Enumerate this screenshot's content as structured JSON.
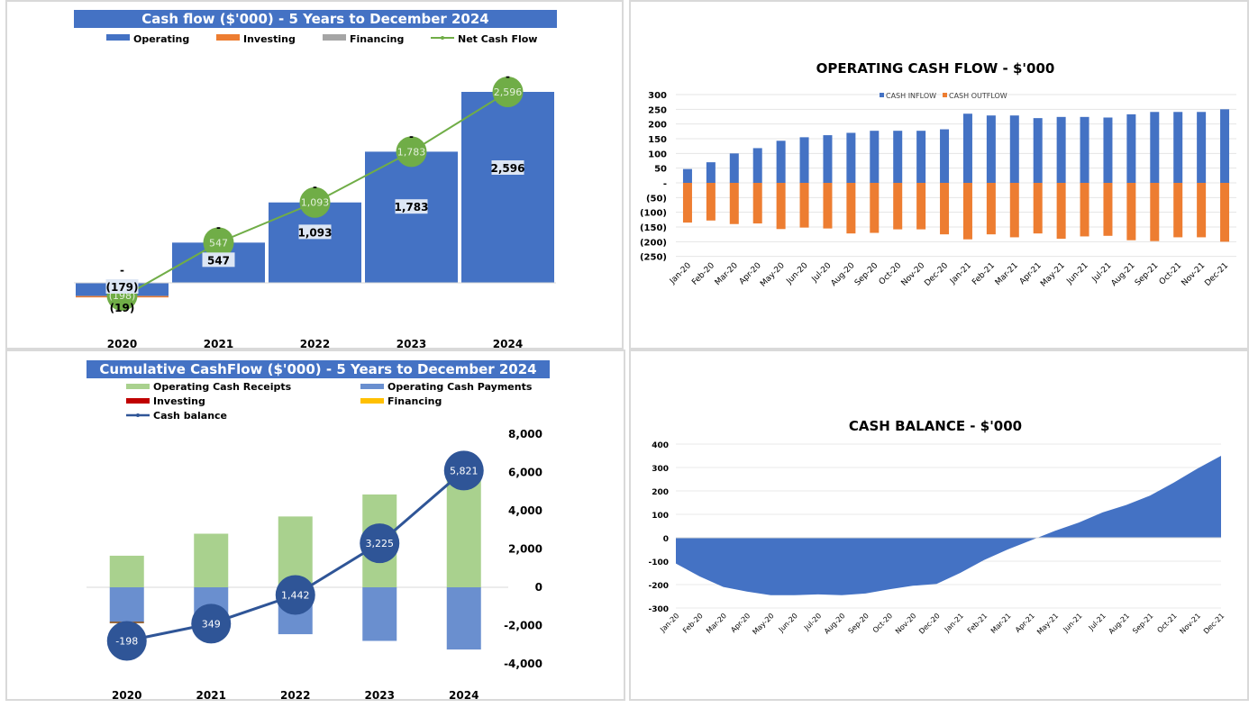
{
  "chart_data": [
    {
      "id": "cashflow-5y",
      "type": "bar",
      "title": "Cash flow ($'000) - 5 Years to December 2024",
      "legend": [
        "Operating",
        "Investing",
        "Financing",
        "Net Cash Flow"
      ],
      "legend_position": "top",
      "categories": [
        "2020",
        "2021",
        "2022",
        "2023",
        "2024"
      ],
      "series": [
        {
          "name": "Operating",
          "type": "bar",
          "color": "#4472C4",
          "values": [
            -179,
            547,
            1093,
            1783,
            2596
          ],
          "labels": [
            "(179)",
            "547",
            "1,093",
            "1,783",
            "2,596"
          ]
        },
        {
          "name": "Investing",
          "type": "bar",
          "color": "#ED7D31",
          "values": [
            -19,
            0,
            0,
            0,
            0
          ],
          "labels": [
            "(19)",
            "-",
            "-",
            "-",
            "-"
          ]
        },
        {
          "name": "Financing",
          "type": "bar",
          "color": "#A5A5A5",
          "values": [
            0,
            0,
            0,
            0,
            0
          ],
          "labels": [
            "-",
            "-",
            "-",
            "-",
            "-"
          ]
        },
        {
          "name": "Net Cash Flow",
          "type": "line",
          "color": "#70AD47",
          "values": [
            -198,
            547,
            1093,
            1783,
            2596
          ],
          "labels": [
            "(198)",
            "547",
            "1,093",
            "1,783",
            "2,596"
          ]
        }
      ],
      "ylim": [
        -400,
        2700
      ],
      "grid": false
    },
    {
      "id": "operating-cash-flow-monthly",
      "type": "bar",
      "title": "OPERATING  CASH FLOW - $'000",
      "legend": [
        "CASH INFLOW",
        "CASH OUTFLOW"
      ],
      "legend_position": "top-right",
      "categories": [
        "Jan-20",
        "Feb-20",
        "Mar-20",
        "Apr-20",
        "May-20",
        "Jun-20",
        "Jul-20",
        "Aug-20",
        "Sep-20",
        "Oct-20",
        "Nov-20",
        "Dec-20",
        "Jan-21",
        "Feb-21",
        "Mar-21",
        "Apr-21",
        "May-21",
        "Jun-21",
        "Jul-21",
        "Aug-21",
        "Sep-21",
        "Oct-21",
        "Nov-21",
        "Dec-21"
      ],
      "series": [
        {
          "name": "CASH INFLOW",
          "color": "#4472C4",
          "values": [
            47,
            70,
            100,
            118,
            143,
            155,
            162,
            170,
            177,
            177,
            177,
            182,
            235,
            229,
            229,
            220,
            224,
            224,
            222,
            233,
            241,
            241,
            241,
            250
          ]
        },
        {
          "name": "CASH OUTFLOW",
          "color": "#ED7D31",
          "values": [
            -135,
            -128,
            -140,
            -138,
            -157,
            -152,
            -155,
            -172,
            -170,
            -158,
            -158,
            -175,
            -192,
            -175,
            -185,
            -172,
            -190,
            -182,
            -180,
            -195,
            -198,
            -185,
            -185,
            -200
          ]
        }
      ],
      "yticks": [
        "300",
        "250",
        "200",
        "150",
        "100",
        "50",
        "-",
        "(50)",
        "(100)",
        "(150)",
        "(200)",
        "(250)"
      ],
      "ylim": [
        -250,
        300
      ],
      "grid": true
    },
    {
      "id": "cumulative-cashflow-5y",
      "type": "bar",
      "title": "Cumulative CashFlow ($'000) - 5 Years to December 2024",
      "legend": [
        "Operating Cash Receipts",
        "Operating Cash Payments",
        "Investing",
        "Financing",
        "Cash balance"
      ],
      "legend_position": "top",
      "categories": [
        "2020",
        "2021",
        "2022",
        "2023",
        "2024"
      ],
      "series": [
        {
          "name": "Operating Cash Receipts",
          "color": "#A9D18E",
          "values": [
            1650,
            2800,
            3700,
            4850,
            5900
          ]
        },
        {
          "name": "Operating Cash Payments",
          "color": "#6A8FCF",
          "values": [
            -1800,
            -2250,
            -2450,
            -2800,
            -3250
          ]
        },
        {
          "name": "Investing",
          "color": "#C00000",
          "values": [
            -20,
            0,
            0,
            0,
            0
          ]
        },
        {
          "name": "Financing",
          "color": "#FFC000",
          "values": [
            0,
            0,
            0,
            0,
            0
          ]
        },
        {
          "name": "Cash balance",
          "type": "line",
          "color": "#2F5597",
          "values": [
            -198,
            349,
            1442,
            3225,
            5821
          ],
          "labels": [
            "-198",
            "349",
            "1,442",
            "3,225",
            "5,821"
          ]
        }
      ],
      "yticks": [
        "8,000",
        "6,000",
        "4,000",
        "2,000",
        "0",
        "-2,000",
        "-4,000"
      ],
      "ylim": [
        -4000,
        8000
      ],
      "grid": false
    },
    {
      "id": "cash-balance-monthly",
      "type": "area",
      "title": "CASH  BALANCE  - $'000",
      "categories": [
        "Jan-20",
        "Feb-20",
        "Mar-20",
        "Apr-20",
        "May-20",
        "Jun-20",
        "Jul-20",
        "Aug-20",
        "Sep-20",
        "Oct-20",
        "Nov-20",
        "Dec-20",
        "Jan-21",
        "Feb-21",
        "Mar-21",
        "Apr-21",
        "May-21",
        "Jun-21",
        "Jul-21",
        "Aug-21",
        "Sep-21",
        "Oct-21",
        "Nov-21",
        "Dec-21"
      ],
      "series": [
        {
          "name": "Cash balance",
          "color": "#4472C4",
          "values": [
            -110,
            -165,
            -210,
            -230,
            -245,
            -245,
            -242,
            -245,
            -238,
            -220,
            -205,
            -197,
            -150,
            -95,
            -50,
            -10,
            30,
            65,
            108,
            140,
            180,
            235,
            295,
            350
          ]
        }
      ],
      "yticks": [
        "400",
        "300",
        "200",
        "100",
        "0",
        "-100",
        "-200",
        "-300"
      ],
      "ylim": [
        -300,
        400
      ],
      "grid": true
    }
  ]
}
